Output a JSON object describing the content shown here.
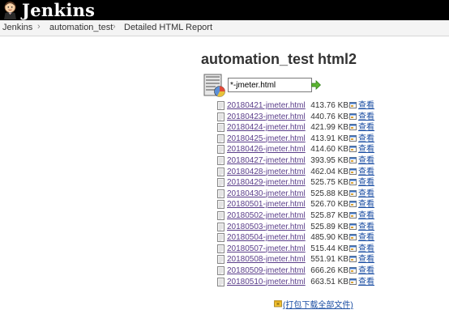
{
  "header": {
    "brand": "Jenkins",
    "logo_icon": "jenkins-butler-icon"
  },
  "breadcrumb": [
    "Jenkins",
    "automation_test",
    "Detailed HTML Report"
  ],
  "breadcrumb_separator": "›",
  "page_title": "automation_test html2",
  "filter": {
    "value": "*-jmeter.html",
    "icon": "folder-chart-icon",
    "go_icon": "green-arrow-icon"
  },
  "files": [
    {
      "name": "20180421-jmeter.html",
      "size": "413.76 KB",
      "view": "查看"
    },
    {
      "name": "20180423-jmeter.html",
      "size": "440.76 KB",
      "view": "查看"
    },
    {
      "name": "20180424-jmeter.html",
      "size": "421.99 KB",
      "view": "查看"
    },
    {
      "name": "20180425-jmeter.html",
      "size": "413.91 KB",
      "view": "查看"
    },
    {
      "name": "20180426-jmeter.html",
      "size": "414.60 KB",
      "view": "查看"
    },
    {
      "name": "20180427-jmeter.html",
      "size": "393.95 KB",
      "view": "查看"
    },
    {
      "name": "20180428-jmeter.html",
      "size": "462.04 KB",
      "view": "查看"
    },
    {
      "name": "20180429-jmeter.html",
      "size": "525.75 KB",
      "view": "查看"
    },
    {
      "name": "20180430-jmeter.html",
      "size": "525.88 KB",
      "view": "查看"
    },
    {
      "name": "20180501-jmeter.html",
      "size": "526.70 KB",
      "view": "查看"
    },
    {
      "name": "20180502-jmeter.html",
      "size": "525.87 KB",
      "view": "查看"
    },
    {
      "name": "20180503-jmeter.html",
      "size": "525.89 KB",
      "view": "查看"
    },
    {
      "name": "20180504-jmeter.html",
      "size": "485.90 KB",
      "view": "查看"
    },
    {
      "name": "20180507-jmeter.html",
      "size": "515.44 KB",
      "view": "查看"
    },
    {
      "name": "20180508-jmeter.html",
      "size": "551.91 KB",
      "view": "查看"
    },
    {
      "name": "20180509-jmeter.html",
      "size": "666.26 KB",
      "view": "查看"
    },
    {
      "name": "20180510-jmeter.html",
      "size": "663.51 KB",
      "view": "查看"
    }
  ],
  "download_all": "(打包下载全部文件)",
  "colors": {
    "header_bg": "#000000",
    "visited_link": "#5a3d8a",
    "link": "#1b4ea3"
  }
}
